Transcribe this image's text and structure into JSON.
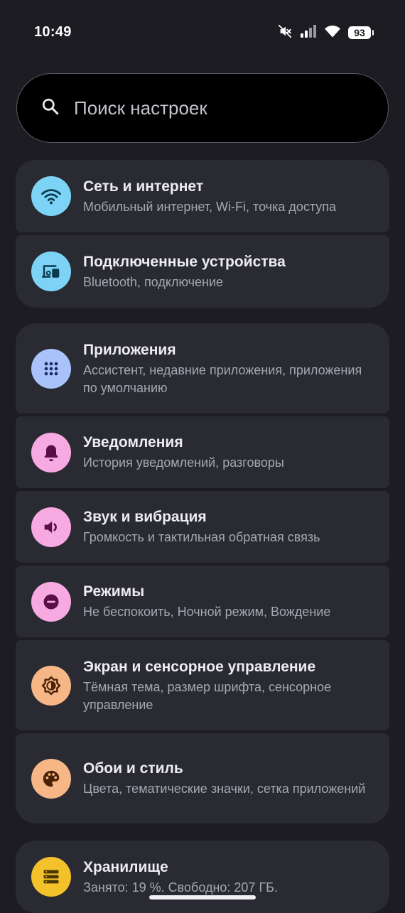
{
  "status_bar": {
    "time": "10:49",
    "battery": "93",
    "icons": [
      "mute-icon",
      "cellular-signal-icon",
      "wifi-icon",
      "battery-icon"
    ]
  },
  "search": {
    "placeholder": "Поиск настроек",
    "icon": "search-icon"
  },
  "groups": [
    {
      "items": [
        {
          "title": "Сеть и интернет",
          "subtitle": "Мобильный интернет, Wi-Fi, точка доступа",
          "icon": "wifi-icon",
          "color": "#7dd3f5"
        },
        {
          "title": "Подключенные устройства",
          "subtitle": "Bluetooth, подключение",
          "icon": "devices-icon",
          "color": "#7dd3f5"
        }
      ]
    },
    {
      "items": [
        {
          "title": "Приложения",
          "subtitle": "Ассистент, недавние приложения, приложения по умолчанию",
          "icon": "apps-grid-icon",
          "color": "#a9c3fa"
        },
        {
          "title": "Уведомления",
          "subtitle": "История уведомлений, разговоры",
          "icon": "bell-icon",
          "color": "#f7a9e2"
        },
        {
          "title": "Звук и вибрация",
          "subtitle": "Громкость и тактильная обратная связь",
          "icon": "speaker-icon",
          "color": "#f7a9e2"
        },
        {
          "title": "Режимы",
          "subtitle": "Не беспокоить, Ночной режим, Вождение",
          "icon": "dnd-icon",
          "color": "#f7a9e2"
        },
        {
          "title": "Экран и сенсорное управление",
          "subtitle": "Тёмная тема, размер шрифта, сенсорное управление",
          "icon": "brightness-icon",
          "color": "#f6b686"
        },
        {
          "title": "Обои и стиль",
          "subtitle": "Цвета, тематические значки, сетка приложений",
          "icon": "palette-icon",
          "color": "#f6b686"
        }
      ]
    },
    {
      "items": [
        {
          "title": "Хранилище",
          "subtitle": "Занято: 19 %. Свободно: 207 ГБ.",
          "icon": "storage-icon",
          "color": "#f3c12a"
        }
      ]
    }
  ]
}
